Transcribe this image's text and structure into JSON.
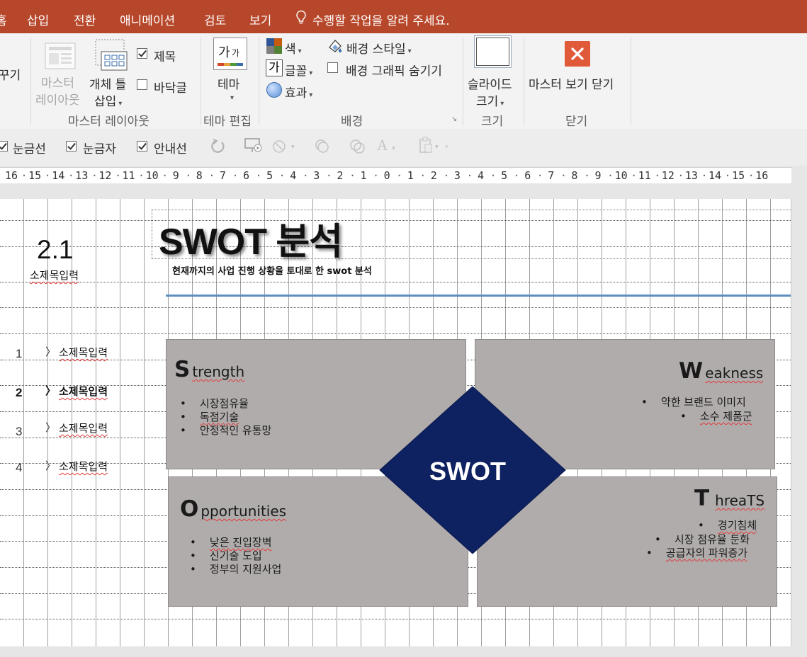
{
  "tabs": [
    "홈",
    "삽입",
    "전환",
    "애니메이션",
    "검토",
    "보기"
  ],
  "tell_me": "수행할 작업을 알려 주세요.",
  "ribbon": {
    "left_cut": "꾸기",
    "master_layout": {
      "line1": "마스터",
      "line2": "레이아웃"
    },
    "insert_placeholder": {
      "line1": "개체 틀",
      "line2": "삽입"
    },
    "title_check": "제목",
    "footer_check": "바닥글",
    "group_master_layout": "마스터 레이아웃",
    "theme_icon": "가",
    "theme": "테마",
    "group_theme_edit": "테마 편집",
    "colors": "색",
    "fonts": "글꼴",
    "effects": "효과",
    "bg_style": "배경 스타일",
    "hide_bg": "배경 그래픽 숨기기",
    "group_bg": "배경",
    "slide_size": {
      "line1": "슬라이드",
      "line2": "크기"
    },
    "group_size": "크기",
    "close_master": "마스터 보기 닫기",
    "group_close": "닫기"
  },
  "subbar": {
    "gridlines": "눈금선",
    "ruler": "눈금자",
    "guides": "안내선"
  },
  "ruler_numbers": [
    "16",
    "15",
    "14",
    "13",
    "12",
    "11",
    "10",
    "9",
    "8",
    "7",
    "6",
    "5",
    "4",
    "3",
    "2",
    "1",
    "0",
    "1",
    "2",
    "3",
    "4",
    "5",
    "6",
    "7",
    "8",
    "9",
    "10",
    "11",
    "12",
    "13",
    "14",
    "15",
    "16"
  ],
  "slide": {
    "section_num": "2.1",
    "section_sub": "소제목입력",
    "title": "SWOT 분석",
    "subtitle": "현재까지의 사업 진행 상황을 토대로 한 swot 분석",
    "nav": [
      {
        "num": "1",
        "label": "소제목입력",
        "bold": false
      },
      {
        "num": "2",
        "label": "소제목입력",
        "bold": true
      },
      {
        "num": "3",
        "label": "소제목입력",
        "bold": false
      },
      {
        "num": "4",
        "label": "소제목입력",
        "bold": false
      }
    ],
    "center": "SWOT",
    "strength": {
      "initial": "S",
      "rest": "trength",
      "items": [
        "시장점유율",
        "독점기술",
        "안정적인 유통망"
      ]
    },
    "weakness": {
      "initial": "W",
      "rest": "eakness",
      "items": [
        "약한 브랜드 이미지",
        "소수 제품군"
      ]
    },
    "opportunities": {
      "initial": "O",
      "rest": "pportunities",
      "items": [
        "낮은 진입장벽",
        "신기술 도입",
        "정부의 지원사업"
      ]
    },
    "threats": {
      "initial": "T",
      "rest": "hreaTS",
      "items": [
        "경기침체",
        "시장 점유율 둔화",
        "공급자의 파워증가"
      ]
    }
  },
  "colors": {
    "tabbar": "#b7472a",
    "close_red": "#e05a3a",
    "diamond": "#0e2160",
    "quad": "#b0acab",
    "accent_line": "#5b8fc2"
  }
}
